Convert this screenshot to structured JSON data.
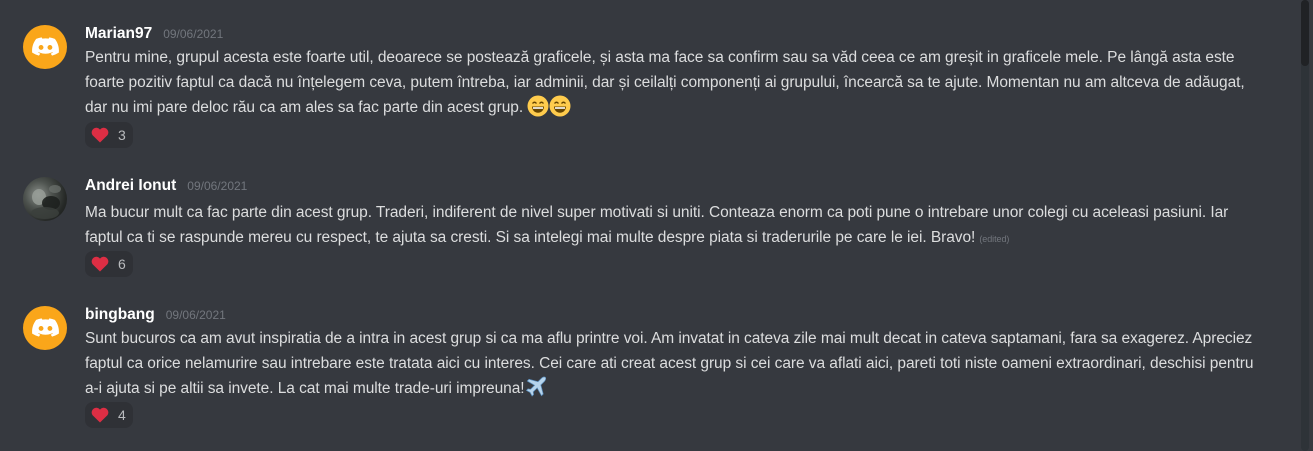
{
  "messages": [
    {
      "username": "Marian97",
      "timestamp": "09/06/2021",
      "avatar": "discord-logo-avatar",
      "text": "Pentru mine, grupul acesta este foarte util, deoarece se postează graficele, și asta ma face sa confirm sau sa văd ceea ce am greșit in graficele mele. Pe lângă asta este foarte pozitiv faptul ca dacă nu înțelegem ceva, putem întreba, iar adminii, dar și ceilalți componenți ai grupului, încearcă sa te ajute. Momentan nu am altceva de adăugat, dar nu imi pare deloc rău ca am ales sa fac parte din acest grup.",
      "emojis": [
        "grinning-face-emoji",
        "grinning-face-emoji"
      ],
      "reaction": {
        "emoji": "heart-icon",
        "count": "3"
      }
    },
    {
      "username": "Andrei Ionut",
      "timestamp": "09/06/2021",
      "avatar": "user-photo-avatar",
      "text": "Ma bucur mult ca fac parte din acest grup. Traderi, indiferent de nivel super motivati si uniti. Conteaza enorm ca poti pune o intrebare unor colegi cu aceleasi pasiuni. Iar faptul ca ti se raspunde mereu cu respect, te ajuta sa cresti. Si sa intelegi mai multe despre piata si traderurile pe care le iei. Bravo!",
      "edited": "(edited)",
      "reaction": {
        "emoji": "heart-icon",
        "count": "6"
      }
    },
    {
      "username": "bingbang",
      "timestamp": "09/06/2021",
      "avatar": "discord-logo-avatar",
      "text": "Sunt bucuros ca am avut inspiratia de a intra in acest grup si ca ma aflu printre voi. Am invatat in cateva zile mai mult decat in cateva saptamani, fara sa exagerez. Apreciez faptul ca orice nelamurire sau intrebare este tratata aici cu interes. Cei care ati creat acest grup si cei care va aflati aici, pareti toti niste oameni extraordinari, deschisi pentru a-i ajuta si pe altii sa invete. La cat mai multe trade-uri impreuna!",
      "emojis": [
        "airplane-emoji"
      ],
      "reaction": {
        "emoji": "heart-icon",
        "count": "4"
      }
    }
  ],
  "colors": {
    "background": "#36393f",
    "username": "#ffffff",
    "text": "#dcddde",
    "timestamp": "#72767d",
    "reaction_bg": "#2f3136",
    "discord_avatar": "#faa61a",
    "heart": "#dd2e44"
  }
}
